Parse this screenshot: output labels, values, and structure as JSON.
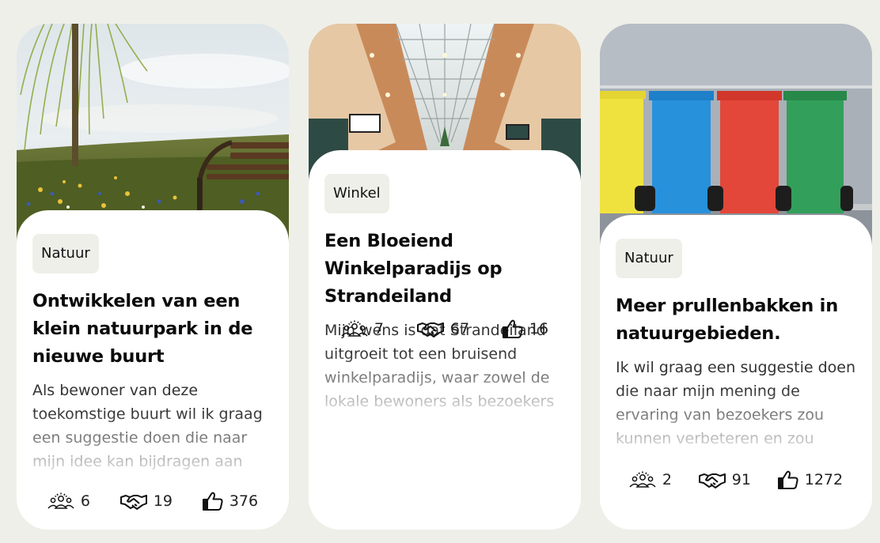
{
  "cards": [
    {
      "tag": "Natuur",
      "title": "Ontwikkelen van een klein natuurpark in de nieuwe buurt",
      "description": "Als bewoner van deze toekomstige buurt wil ik graag een suggestie doen die naar mijn idee kan bijdragen aan",
      "supporters": "6",
      "collaborations": "19",
      "likes": "376",
      "image_icon": "park-bench-photo"
    },
    {
      "tag": "Winkel",
      "title": "Een Bloeiend Winkelparadijs op Strandeiland",
      "description": "Mijn wens is dat Strandeiland uitgroeit tot een bruisend winkelparadijs, waar zowel de lokale bewoners als bezoekers",
      "supporters": "7",
      "collaborations": "67",
      "likes": "16",
      "image_icon": "shopping-arcade-photo"
    },
    {
      "tag": "Natuur",
      "title": "Meer prullenbakken in natuurgebieden.",
      "description": "Ik wil graag een suggestie doen die naar mijn mening de ervaring van bezoekers zou kunnen verbeteren en zou",
      "supporters": "2",
      "collaborations": "91",
      "likes": "1272",
      "image_icon": "waste-bins-photo"
    }
  ],
  "icons": {
    "supporters": "people-group-icon",
    "collaborations": "handshake-icon",
    "likes": "thumbs-up-icon"
  }
}
